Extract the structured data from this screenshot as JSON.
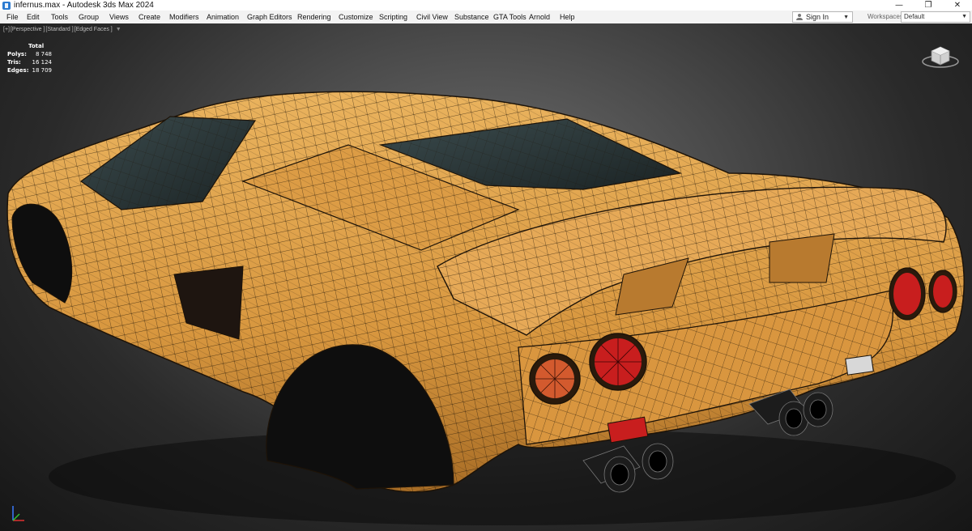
{
  "window": {
    "title": "infernus.max - Autodesk 3ds Max 2024",
    "minimize_glyph": "—",
    "restore_glyph": "❐",
    "close_glyph": "✕"
  },
  "menu": {
    "items": [
      "File",
      "Edit",
      "Tools",
      "Group",
      "Views",
      "Create",
      "Modifiers",
      "Animation",
      "Graph Editors",
      "Rendering",
      "Customize",
      "Scripting",
      "Civil View",
      "Substance",
      "GTA Tools",
      "Arnold",
      "Help"
    ]
  },
  "signin": {
    "label": "Sign In"
  },
  "workspaces": {
    "label": "Workspaces:",
    "value": "Default"
  },
  "viewport": {
    "label_parts": [
      "[+]",
      "[Perspective ]",
      "[Standard ]",
      "[Edged Faces ]"
    ],
    "filter_glyph": "▼",
    "stats": {
      "header": "Total",
      "rows": [
        {
          "key": "Polys:",
          "value": "8 748"
        },
        {
          "key": "Tris:",
          "value": "16 124"
        },
        {
          "key": "Edges:",
          "value": "18 709"
        }
      ]
    },
    "viewcube_icon": "viewcube-icon",
    "model_colors": {
      "body": "#e1a24c",
      "wire": "#1d1308",
      "taillight": "#c81e1e",
      "glass": "#2e3a3c"
    }
  }
}
